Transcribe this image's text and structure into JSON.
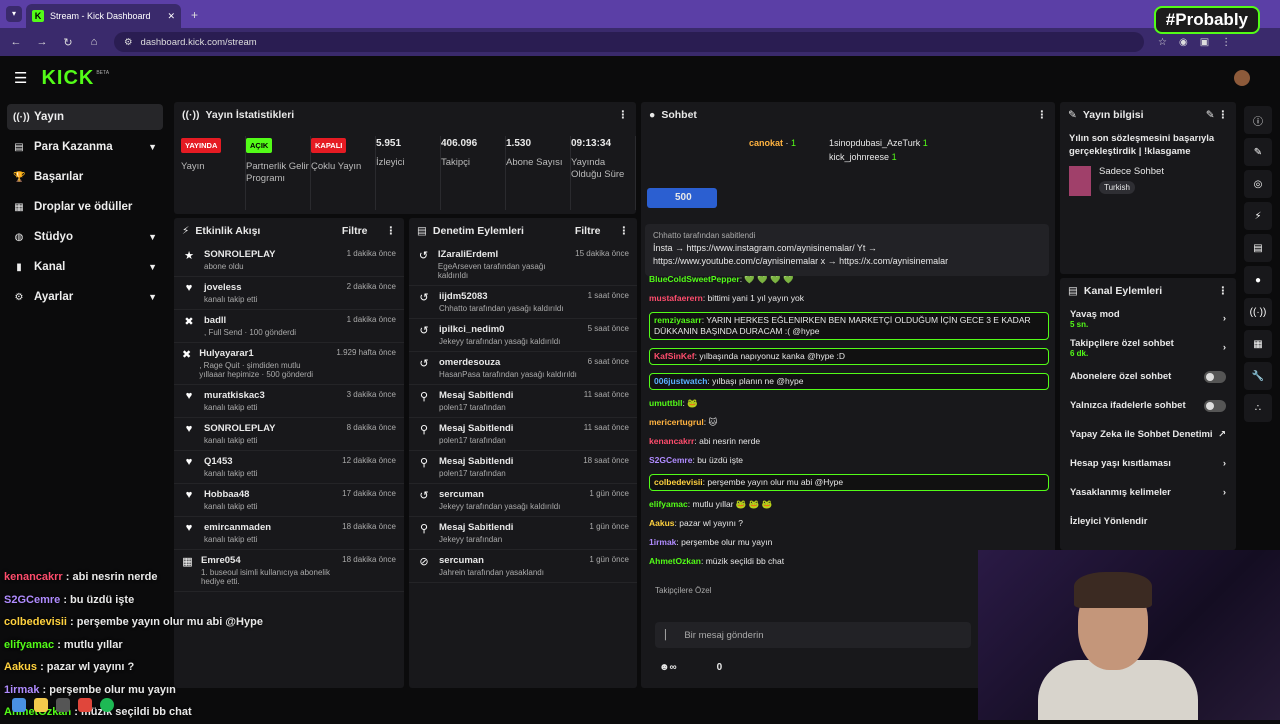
{
  "browser": {
    "tab_title": "Stream - Kick Dashboard",
    "url": "dashboard.kick.com/stream",
    "overlay_logo": "#Probably"
  },
  "app": {
    "logo": "KICK",
    "beta": "BETA"
  },
  "sidebar": {
    "items": [
      {
        "label": "Yayın"
      },
      {
        "label": "Para Kazanma"
      },
      {
        "label": "Başarılar"
      },
      {
        "label": "Droplar ve ödüller"
      },
      {
        "label": "Stüdyo"
      },
      {
        "label": "Kanal"
      },
      {
        "label": "Ayarlar"
      }
    ]
  },
  "stats": {
    "title": "Yayın İstatistikleri",
    "items": [
      {
        "badge": "YAYINDA",
        "badge_color": "#e51b23",
        "label": "Yayın"
      },
      {
        "badge": "AÇIK",
        "badge_color": "#53fc18",
        "label": "Partnerlik Gelir Programı"
      },
      {
        "badge": "KAPALI",
        "badge_color": "#e51b23",
        "label": "Çoklu Yayın"
      },
      {
        "value": "5.951",
        "label": "İzleyici"
      },
      {
        "value": "406.096",
        "label": "Takipçi"
      },
      {
        "value": "1.530",
        "label": "Abone Sayısı"
      },
      {
        "value": "09:13:34",
        "label": "Yayında Olduğu Süre"
      }
    ]
  },
  "activity": {
    "title": "Etkinlik Akışı",
    "filter": "Filtre",
    "items": [
      {
        "name": "SONROLEPLAY",
        "sub": "abone oldu",
        "time": "1 dakika önce",
        "icon": "★"
      },
      {
        "name": "joveless",
        "sub": "kanalı takip etti",
        "time": "2 dakika önce",
        "icon": "♥"
      },
      {
        "name": "badll",
        "sub": ", Full Send · 100 gönderdi",
        "time": "1 dakika önce",
        "icon": "✖"
      },
      {
        "name": "Hulyayarar1",
        "sub": ", Rage Quit · şimdiden mutlu yıllaaar hepimize · 500 gönderdi",
        "time": "1.929 hafta önce",
        "icon": "✖"
      },
      {
        "name": "muratkiskac3",
        "sub": "kanalı takip etti",
        "time": "3 dakika önce",
        "icon": "♥"
      },
      {
        "name": "SONROLEPLAY",
        "sub": "kanalı takip etti",
        "time": "8 dakika önce",
        "icon": "♥"
      },
      {
        "name": "Q1453",
        "sub": "kanalı takip etti",
        "time": "12 dakika önce",
        "icon": "♥"
      },
      {
        "name": "Hobbaa48",
        "sub": "kanalı takip etti",
        "time": "17 dakika önce",
        "icon": "♥"
      },
      {
        "name": "emircanmaden",
        "sub": "kanalı takip etti",
        "time": "18 dakika önce",
        "icon": "♥"
      },
      {
        "name": "Emre054",
        "sub": "1. buseoul isimli kullanıcıya abonelik hediye etti.",
        "time": "18 dakika önce",
        "icon": "▦"
      }
    ]
  },
  "moderation": {
    "title": "Denetim Eylemleri",
    "filter": "Filtre",
    "items": [
      {
        "name": "IZaraliErdemI",
        "sub": "EgeArseven tarafından yasağı kaldırıldı",
        "time": "15 dakika önce",
        "icon": "↺"
      },
      {
        "name": "iijdm52083",
        "sub": "Chhatto tarafından yasağı kaldırıldı",
        "time": "1 saat önce",
        "icon": "↺"
      },
      {
        "name": "ipilkci_nedim0",
        "sub": "Jekeyy tarafından yasağı kaldırıldı",
        "time": "5 saat önce",
        "icon": "↺"
      },
      {
        "name": "omerdesouza",
        "sub": "HasanPasa tarafından yasağı kaldırıldı",
        "time": "6 saat önce",
        "icon": "↺"
      },
      {
        "name": "Mesaj Sabitlendi",
        "sub": "polen17 tarafından",
        "time": "11 saat önce",
        "icon": "⚲"
      },
      {
        "name": "Mesaj Sabitlendi",
        "sub": "polen17 tarafından",
        "time": "11 saat önce",
        "icon": "⚲"
      },
      {
        "name": "Mesaj Sabitlendi",
        "sub": "polen17 tarafından",
        "time": "18 saat önce",
        "icon": "⚲"
      },
      {
        "name": "sercuman",
        "sub": "Jekeyy tarafından yasağı kaldırıldı",
        "time": "1 gün önce",
        "icon": "↺"
      },
      {
        "name": "Mesaj Sabitlendi",
        "sub": "Jekeyy tarafından",
        "time": "1 gün önce",
        "icon": "⚲"
      },
      {
        "name": "sercuman",
        "sub": "Jahrein tarafından yasaklandı",
        "time": "1 gün önce",
        "icon": "⊘"
      }
    ]
  },
  "chat": {
    "title": "Sohbet",
    "leader1": "canokat",
    "leader1_count": "1",
    "leader2": "1sinopdubasi_AzeTurk",
    "leader2_count": "1",
    "leader3": "kick_johnreese",
    "leader3_count": "1",
    "gift": "500",
    "pinned_by": "Chhatto tarafından sabitlendi",
    "pinned_text": "İnsta → https://www.instagram.com/aynisinemalar/ Yt → https://www.youtube.com/c/aynisinemalar x → https://x.com/aynisinemalar",
    "messages": [
      {
        "user": "BlueColdSweetPepper",
        "text": "💚 💚 💚 💚",
        "color": "#53fc18",
        "hl": false
      },
      {
        "user": "mustafaerern",
        "text": "bittimi yani 1 yıl yayın yok",
        "color": "#ff4d6d",
        "hl": false
      },
      {
        "user": "remziyasarr",
        "text": "YARIN HERKES EĞLENIRKEN BEN MARKETÇİ OLDUĞUM İÇİN GECE 3 E KADAR DÜKKANIN BAŞINDA DURACAM :( @hype",
        "color": "#53fc18",
        "hl": true
      },
      {
        "user": "KafSinKef",
        "text": "yılbaşında napıyonuz kanka @hype :D",
        "color": "#ff4d6d",
        "hl": true
      },
      {
        "user": "006justwatch",
        "text": "yılbaşı planın ne @hype",
        "color": "#5ab0ff",
        "hl": true
      },
      {
        "user": "umuttbll",
        "text": "🐸",
        "color": "#53fc18",
        "hl": false
      },
      {
        "user": "mericertugrul",
        "text": "🐱",
        "color": "#ffb340",
        "hl": false
      },
      {
        "user": "kenancakrr",
        "text": "abi nesrin nerde",
        "color": "#ff4d6d",
        "hl": false
      },
      {
        "user": "S2GCemre",
        "text": "bu üzdü işte",
        "color": "#b08cff",
        "hl": false
      },
      {
        "user": "colbedevisii",
        "text": "perşembe yayın olur mu abi @Hype",
        "color": "#ffd23f",
        "hl": true
      },
      {
        "user": "elifyamac",
        "text": "mutlu yıllar 🐸 🐸 🐸",
        "color": "#53fc18",
        "hl": false
      },
      {
        "user": "Aakus",
        "text": "pazar wl yayını ?",
        "color": "#ffd23f",
        "hl": false
      },
      {
        "user": "1irmak",
        "text": "perşembe olur mu yayın",
        "color": "#b08cff",
        "hl": false
      },
      {
        "user": "AhmetOzkan",
        "text": "müzik seçildi bb chat",
        "color": "#53fc18",
        "hl": false
      }
    ],
    "followers_only": "Takipçilere Özel",
    "input_placeholder": "Bir mesaj gönderin",
    "points": "0"
  },
  "info": {
    "title": "Yayın bilgisi",
    "stream_title": "Yılın son sözleşmesini başarıyla gerçekleştirdik | !klasgame",
    "category": "Sadece Sohbet",
    "language": "Turkish"
  },
  "channel_actions": {
    "title": "Kanal Eylemleri",
    "items": [
      {
        "label": "Yavaş mod",
        "sub": "5 sn."
      },
      {
        "label": "Takipçilere özel sohbet",
        "sub": "6 dk."
      },
      {
        "label": "Abonelere özel sohbet",
        "sub": ""
      },
      {
        "label": "Yalnızca ifadelerle sohbet",
        "sub": ""
      },
      {
        "label": "Yapay Zeka ile Sohbet Denetimi",
        "sub": ""
      },
      {
        "label": "Hesap yaşı kısıtlaması",
        "sub": ""
      },
      {
        "label": "Yasaklanmış kelimeler",
        "sub": ""
      },
      {
        "label": "İzleyici Yönlendir",
        "sub": ""
      }
    ]
  },
  "overlay_chat": [
    {
      "user": "kenancakrr",
      "text": ": abi nesrin nerde",
      "color": "#ff4d6d"
    },
    {
      "user": "S2GCemre",
      "text": ": bu üzdü işte",
      "color": "#b08cff"
    },
    {
      "user": "colbedevisii",
      "text": ": perşembe yayın olur mu abi @Hype",
      "color": "#ffd23f"
    },
    {
      "user": "elifyamac",
      "text": ": mutlu yıllar",
      "color": "#53fc18"
    },
    {
      "user": "Aakus",
      "text": ": pazar wl yayını ?",
      "color": "#ffd23f"
    },
    {
      "user": "1irmak",
      "text": ": perşembe olur mu yayın",
      "color": "#b08cff"
    },
    {
      "user": "AhmetOzkan",
      "text": ": müzik seçildi bb chat",
      "color": "#53fc18"
    }
  ]
}
